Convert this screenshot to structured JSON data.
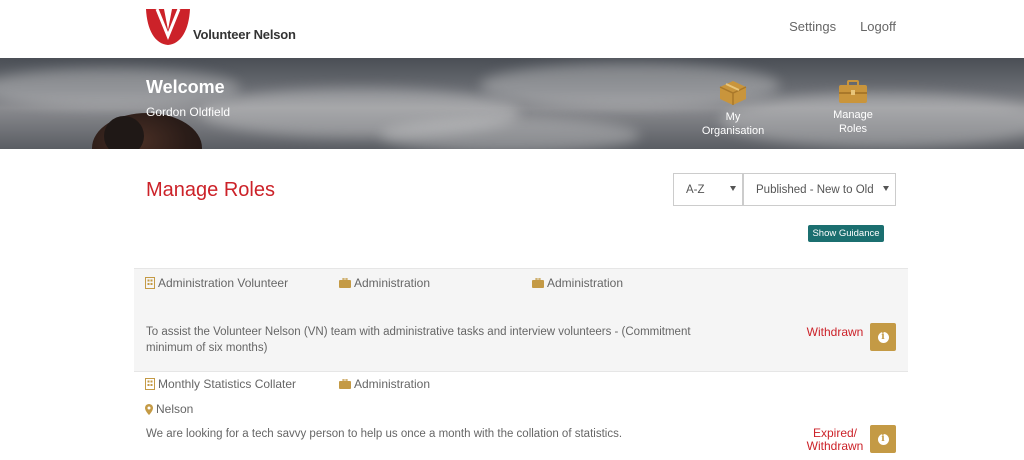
{
  "brand": {
    "name": "Volunteer Nelson",
    "logo_color": "#cc2229"
  },
  "nav": {
    "settings": "Settings",
    "logoff": "Logoff"
  },
  "banner": {
    "welcome": "Welcome",
    "user": "Gordon Oldfield",
    "links": [
      {
        "label_line1": "My",
        "label_line2": "Organisation",
        "icon": "box-icon"
      },
      {
        "label_line1": "Manage",
        "label_line2": "Roles",
        "icon": "briefcase-icon"
      }
    ]
  },
  "page": {
    "title": "Manage Roles",
    "sort_alpha": "A-Z",
    "sort_published": "Published - New to Old",
    "guidance_button": "Show Guidance"
  },
  "roles": [
    {
      "name": "Administration Volunteer",
      "category": "Administration",
      "category2": "Administration",
      "location": "",
      "description": "To assist the Volunteer Nelson (VN) team with administrative tasks and interview volunteers - (Commitment minimum of six months)",
      "status": "Withdrawn"
    },
    {
      "name": "Monthly Statistics Collater",
      "category": "Administration",
      "location": "Nelson",
      "description": "We are looking for a tech savvy person to help us once a month with the collation of statistics.",
      "status_line1": "Expired/",
      "status_line2": "Withdrawn"
    }
  ],
  "colors": {
    "accent_red": "#cc2229",
    "gold": "#c49a45",
    "teal": "#1b6f70"
  }
}
